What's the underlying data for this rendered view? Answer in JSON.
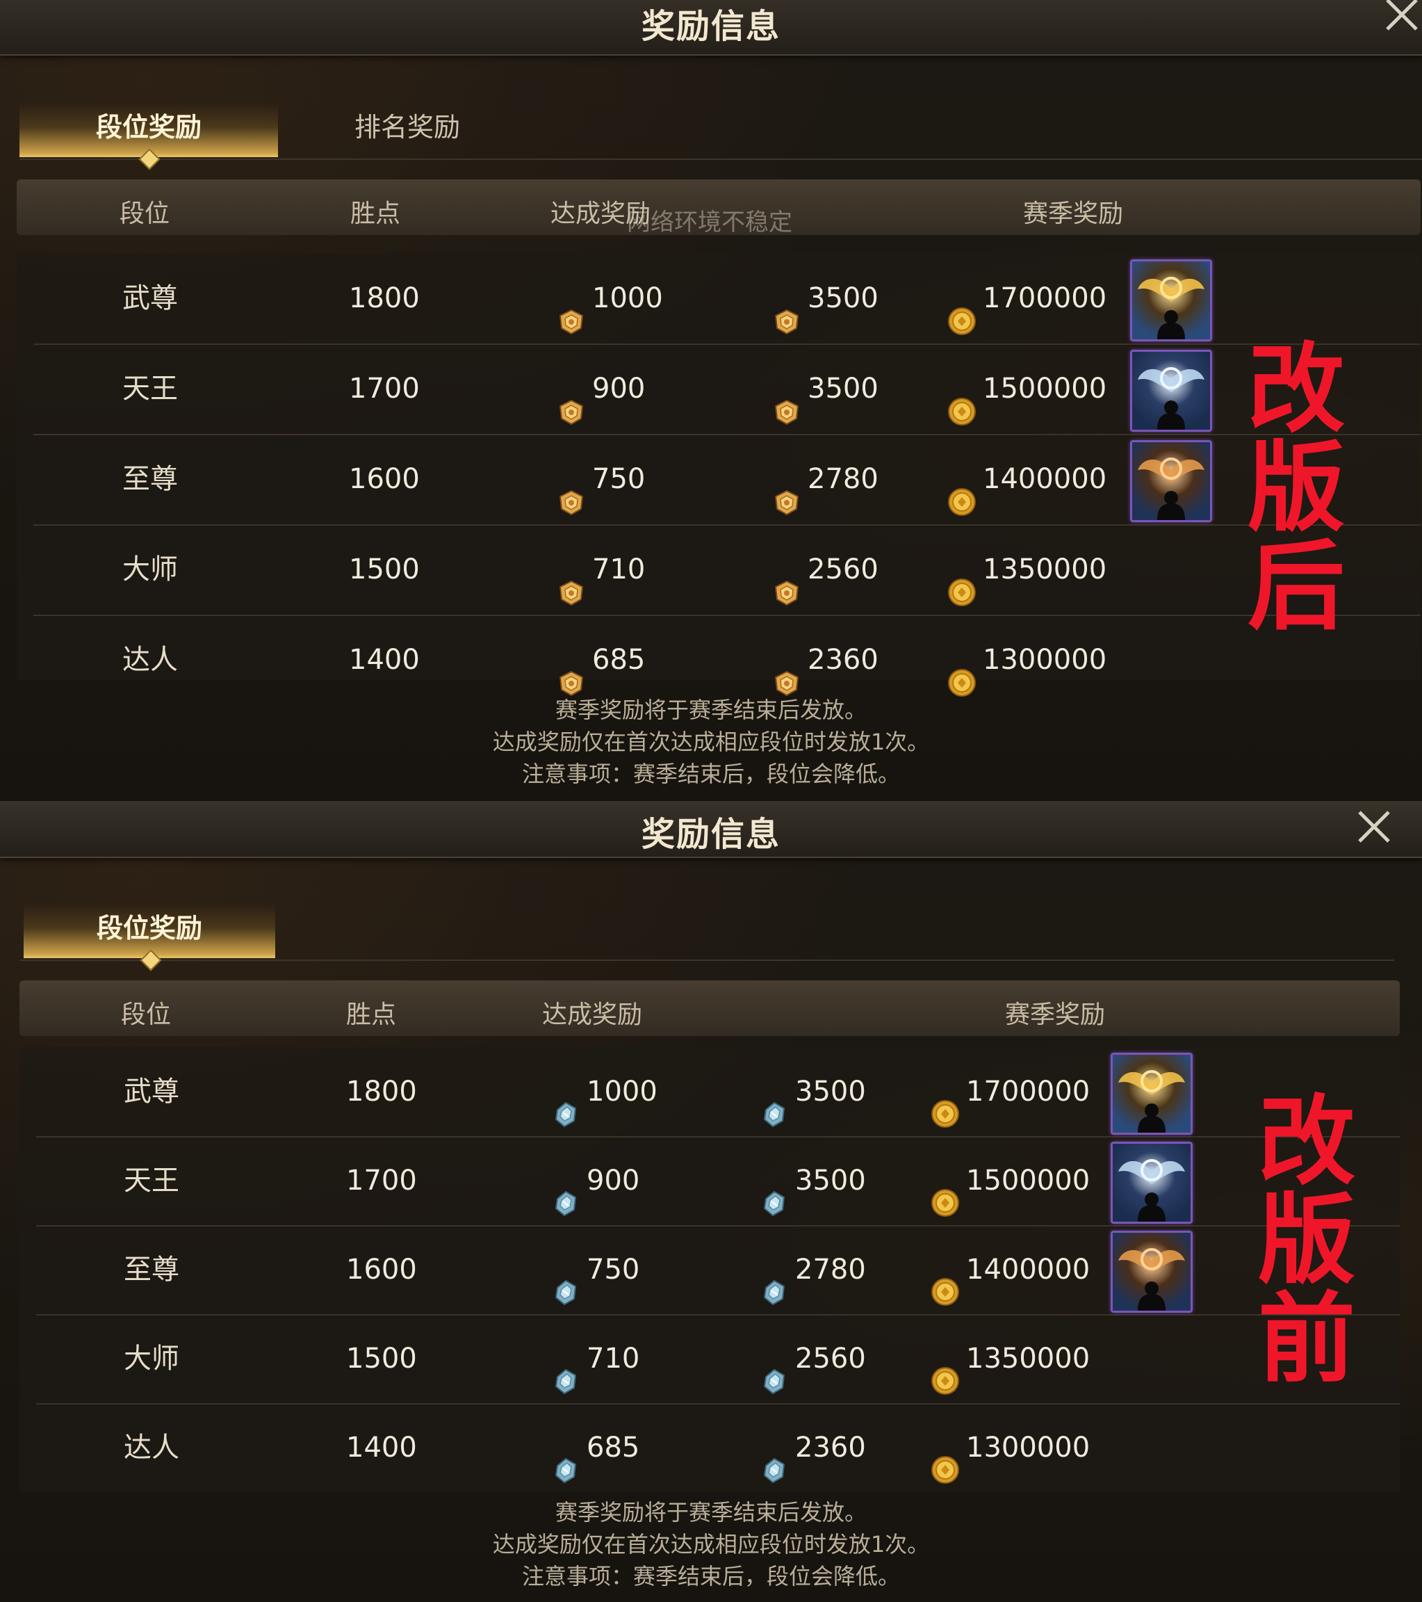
{
  "colors": {
    "accent_gold": "#caa048",
    "stamp_red": "#f0162a",
    "frame_purple": "#7a55b8"
  },
  "after": {
    "title": "奖励信息",
    "tabs": [
      {
        "label": "段位奖励",
        "active": true
      },
      {
        "label": "排名奖励",
        "active": false
      }
    ],
    "headers": {
      "rank": "段位",
      "points": "胜点",
      "achieve": "达成奖励",
      "season": "赛季奖励"
    },
    "overlay_text": "网络环境不稳定",
    "rows": [
      {
        "rank": "武尊",
        "points": "1800",
        "achieve": "1000",
        "season_a": "3500",
        "season_b": "1700000",
        "frame": "gold-icon-frame"
      },
      {
        "rank": "天王",
        "points": "1700",
        "achieve": "900",
        "season_a": "3500",
        "season_b": "1500000",
        "frame": "silver-icon-frame"
      },
      {
        "rank": "至尊",
        "points": "1600",
        "achieve": "750",
        "season_a": "2780",
        "season_b": "1400000",
        "frame": "bronze-icon-frame"
      },
      {
        "rank": "大师",
        "points": "1500",
        "achieve": "710",
        "season_a": "2560",
        "season_b": "1350000"
      },
      {
        "rank": "达人",
        "points": "1400",
        "achieve": "685",
        "season_a": "2360",
        "season_b": "1300000"
      }
    ],
    "notes": [
      "赛季奖励将于赛季结束后发放。",
      "达成奖励仅在首次达成相应段位时发放1次。",
      "注意事项：赛季结束后，段位会降低。"
    ],
    "stamp": [
      "改",
      "版",
      "后"
    ],
    "achieve_icon": "gold-medal-icon",
    "season_icon": "gold-coin-icon"
  },
  "before": {
    "title": "奖励信息",
    "tabs": [
      {
        "label": "段位奖励",
        "active": true
      }
    ],
    "headers": {
      "rank": "段位",
      "points": "胜点",
      "achieve": "达成奖励",
      "season": "赛季奖励"
    },
    "rows": [
      {
        "rank": "武尊",
        "points": "1800",
        "achieve": "1000",
        "season_a": "3500",
        "season_b": "1700000",
        "frame": "gold-icon-frame"
      },
      {
        "rank": "天王",
        "points": "1700",
        "achieve": "900",
        "season_a": "3500",
        "season_b": "1500000",
        "frame": "silver-icon-frame"
      },
      {
        "rank": "至尊",
        "points": "1600",
        "achieve": "750",
        "season_a": "2780",
        "season_b": "1400000",
        "frame": "bronze-icon-frame"
      },
      {
        "rank": "大师",
        "points": "1500",
        "achieve": "710",
        "season_a": "2560",
        "season_b": "1350000"
      },
      {
        "rank": "达人",
        "points": "1400",
        "achieve": "685",
        "season_a": "2360",
        "season_b": "1300000"
      }
    ],
    "notes": [
      "赛季奖励将于赛季结束后发放。",
      "达成奖励仅在首次达成相应段位时发放1次。",
      "注意事项：赛季结束后，段位会降低。"
    ],
    "stamp": [
      "改",
      "版",
      "前"
    ],
    "achieve_icon": "blue-crystal-icon",
    "season_icon": "gold-coin-icon"
  }
}
